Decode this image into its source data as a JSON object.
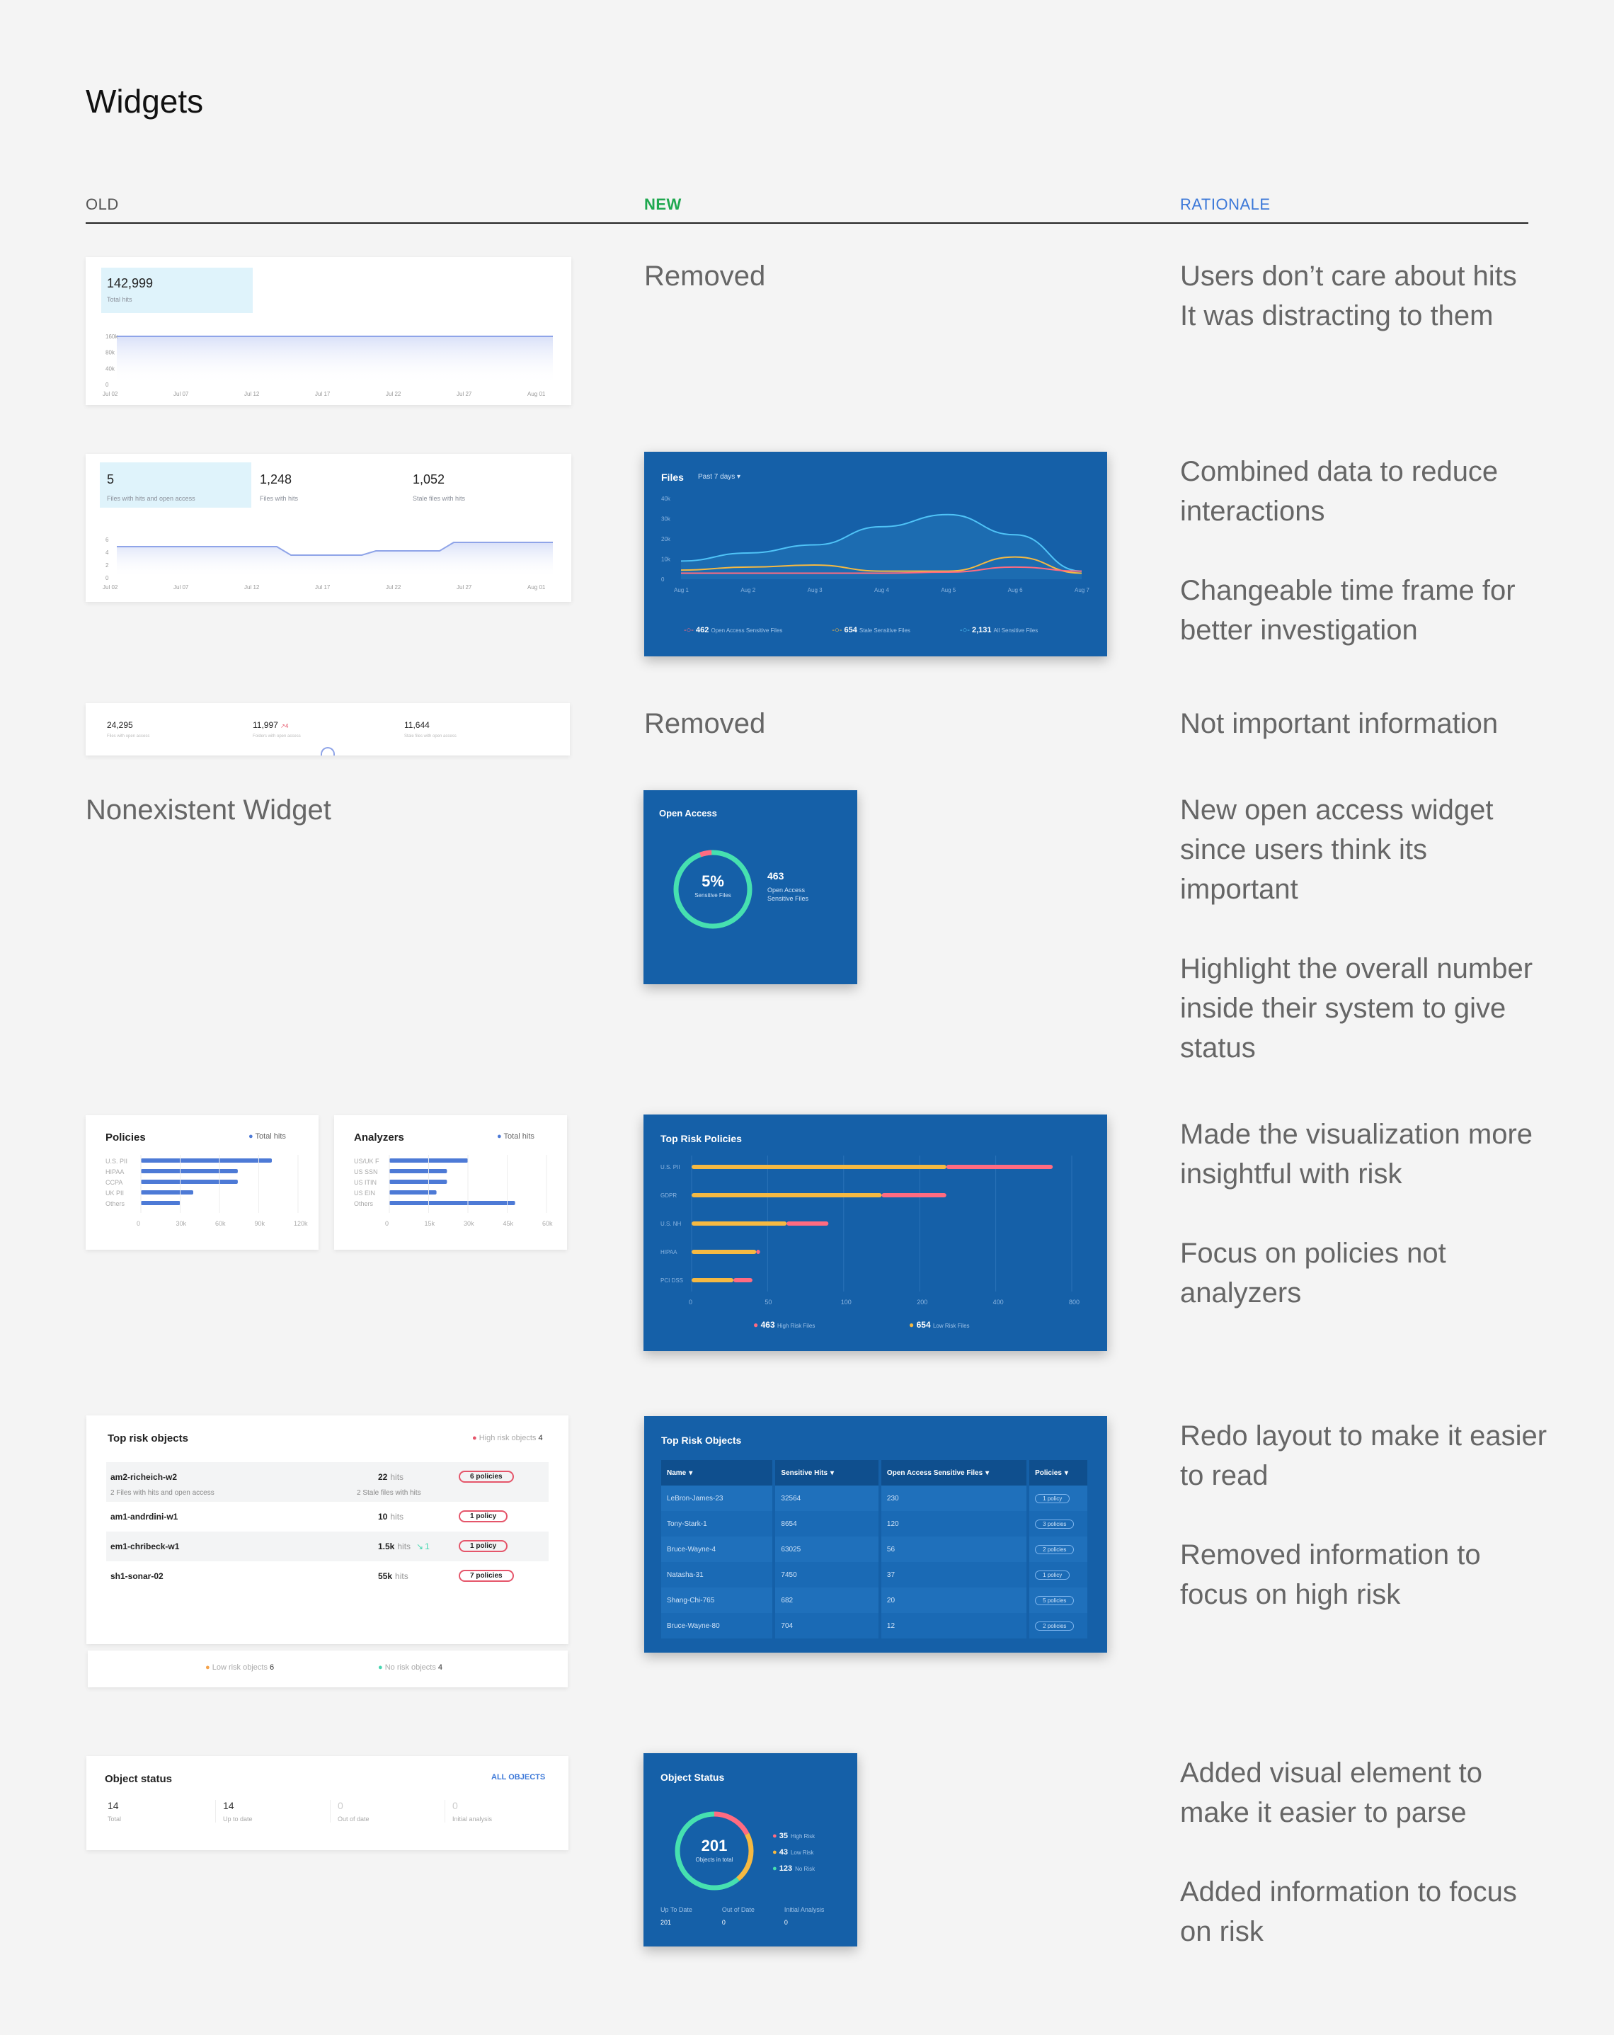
{
  "page": {
    "title": "Widgets"
  },
  "columns": {
    "old": "OLD",
    "new": "NEW",
    "rationale": "RATIONALE"
  },
  "colors": {
    "old": "#555555",
    "new": "#1fa84f",
    "rationale": "#3c78d8",
    "widget_bg": "#1560a8"
  },
  "rows": {
    "r1": {
      "new_text": "Removed",
      "rationale": [
        "Users don’t care about hits",
        "It was distracting to them"
      ]
    },
    "r2": {
      "rationale": [
        "Combined data to reduce interactions",
        "Changeable time frame for better investigation"
      ]
    },
    "r3": {
      "new_text": "Removed",
      "rationale": [
        "Not important information"
      ]
    },
    "r4": {
      "old_text": "Nonexistent Widget",
      "rationale": [
        "New open access widget since users think its important",
        "Highlight the overall number inside their system to give status"
      ]
    },
    "r5": {
      "rationale": [
        "Made the visualization more insightful with risk",
        "Focus on policies not analyzers"
      ]
    },
    "r6": {
      "rationale": [
        "Redo layout to make it easier to read",
        "Removed information to focus on high risk"
      ]
    },
    "r7": {
      "rationale": [
        "Added visual element to make it easier to parse",
        "Added information to focus on risk"
      ]
    }
  },
  "old1": {
    "value": "142,999",
    "label": "Total hits",
    "yticks": [
      "160k",
      "80k",
      "40k",
      "0"
    ],
    "xticks": [
      "Jul 02",
      "Jul 07",
      "Jul 12",
      "Jul 17",
      "Jul 22",
      "Jul 27",
      "Aug 01"
    ]
  },
  "old2": {
    "stats": [
      {
        "value": "5",
        "label": "Files with hits and open access"
      },
      {
        "value": "1,248",
        "label": "Files with hits"
      },
      {
        "value": "1,052",
        "label": "Stale files with hits"
      }
    ],
    "yticks": [
      "6",
      "4",
      "2",
      "0"
    ],
    "xticks": [
      "Jul 02",
      "Jul 07",
      "Jul 12",
      "Jul 17",
      "Jul 22",
      "Jul 27",
      "Aug 01"
    ]
  },
  "files_widget": {
    "title": "Files",
    "timeframe": "Past 7 days",
    "legend": [
      {
        "value": "462",
        "label": "Open Access Sensitive Files"
      },
      {
        "value": "654",
        "label": "Stale Sensitive Files"
      },
      {
        "value": "2,131",
        "label": "All Sensitive Files"
      }
    ]
  },
  "chart_data": [
    {
      "type": "line",
      "title": "Files",
      "x": [
        "Aug 1",
        "Aug 2",
        "Aug 3",
        "Aug 4",
        "Aug 5",
        "Aug 6",
        "Aug 7"
      ],
      "yticks": [
        "40k",
        "30k",
        "20k",
        "10k",
        "0"
      ],
      "ylim": [
        0,
        40000
      ],
      "series": [
        {
          "name": "All Sensitive Files",
          "values": [
            9000,
            13000,
            17000,
            26000,
            32000,
            22000,
            4000
          ]
        },
        {
          "name": "Stale Sensitive Files",
          "values": [
            4500,
            6000,
            7000,
            4000,
            4000,
            11000,
            3000
          ]
        },
        {
          "name": "Open Access Sensitive Files",
          "values": [
            3000,
            3000,
            3000,
            3000,
            3500,
            6000,
            4000
          ]
        }
      ]
    },
    {
      "type": "bar",
      "title": "Top Risk Policies",
      "categories": [
        "U.S. PII",
        "GDPR",
        "U.S. NH",
        "HIPAA",
        "PCI DSS"
      ],
      "xticks": [
        "0",
        "50",
        "100",
        "200",
        "400",
        "800"
      ],
      "series": [
        {
          "name": "Low Risk Files",
          "values": [
            0.67,
            0.5,
            0.25,
            0.17,
            0.11
          ]
        },
        {
          "name": "High Risk Files",
          "values": [
            0.28,
            0.17,
            0.11,
            0.01,
            0.05
          ]
        }
      ],
      "legend": [
        {
          "value": "463",
          "label": "High Risk Files"
        },
        {
          "value": "654",
          "label": "Low Risk Files"
        }
      ]
    },
    {
      "type": "bar",
      "title": "Policies",
      "categories": [
        "U.S. PII",
        "HIPAA",
        "CCPA",
        "UK PII",
        "Others"
      ],
      "values": [
        100000,
        74000,
        74000,
        40000,
        30000
      ],
      "xticks": [
        "0",
        "30k",
        "60k",
        "90k",
        "120k"
      ],
      "legend": [
        "Total hits"
      ]
    },
    {
      "type": "bar",
      "title": "Analyzers",
      "categories": [
        "US/UK F",
        "US SSN",
        "US ITIN",
        "US EIN",
        "Others"
      ],
      "values": [
        30000,
        22000,
        22000,
        18000,
        48000
      ],
      "xticks": [
        "0",
        "15k",
        "30k",
        "45k",
        "60k"
      ],
      "legend": [
        "Total hits"
      ]
    }
  ],
  "old3": {
    "stats": [
      {
        "value": "24,295",
        "label": "Files with open access"
      },
      {
        "value": "11,997",
        "label": "Folders with open access",
        "delta": "4"
      },
      {
        "value": "11,644",
        "label": "Stale files with open access"
      }
    ]
  },
  "open_access": {
    "title": "Open Access",
    "percent": "5%",
    "percent_label": "Sensitive Files",
    "value": "463",
    "label": "Open Access Sensitive Files"
  },
  "top_risk_objects_old": {
    "title": "Top risk objects",
    "high_label": "High risk objects",
    "high_count": "4",
    "rows": [
      {
        "name": "am2-richeich-w2",
        "hits": "22",
        "policies": "6 policies",
        "sub1": "2 Files with hits and open access",
        "sub2": "2 Stale files with hits"
      },
      {
        "name": "am1-andrdini-w1",
        "hits": "10",
        "policies": "1 policy"
      },
      {
        "name": "em1-chribeck-w1",
        "hits": "1.5k",
        "policies": "1 policy",
        "delta": "1"
      },
      {
        "name": "sh1-sonar-02",
        "hits": "55k",
        "policies": "7 policies"
      }
    ],
    "hits_word": "hits",
    "low_label": "Low risk objects",
    "low_count": "6",
    "no_label": "No risk objects",
    "no_count": "4"
  },
  "top_risk_objects_new": {
    "title": "Top Risk Objects",
    "headers": [
      "Name",
      "Sensitive Hits",
      "Open Access Sensitive Files",
      "Policies"
    ],
    "rows": [
      [
        "LeBron-James-23",
        "32564",
        "230",
        "1 policy"
      ],
      [
        "Tony-Stark-1",
        "8654",
        "120",
        "3 policies"
      ],
      [
        "Bruce-Wayne-4",
        "63025",
        "56",
        "2 policies"
      ],
      [
        "Natasha-31",
        "7450",
        "37",
        "1 policy"
      ],
      [
        "Shang-Chi-765",
        "682",
        "20",
        "5 policies"
      ],
      [
        "Bruce-Wayne-80",
        "704",
        "12",
        "2 policies"
      ]
    ]
  },
  "object_status_old": {
    "title": "Object status",
    "link": "ALL OBJECTS",
    "stats": [
      {
        "value": "14",
        "label": "Total"
      },
      {
        "value": "14",
        "label": "Up to date"
      },
      {
        "value": "0",
        "label": "Out of date"
      },
      {
        "value": "0",
        "label": "Initial analysis"
      }
    ]
  },
  "object_status_new": {
    "title": "Object Status",
    "total": "201",
    "total_label": "Objects in total",
    "legend": [
      {
        "value": "35",
        "label": "High Risk"
      },
      {
        "value": "43",
        "label": "Low Risk"
      },
      {
        "value": "123",
        "label": "No Risk"
      }
    ],
    "bottom": [
      {
        "label": "Up To Date",
        "value": "201"
      },
      {
        "label": "Out of Date",
        "value": "0"
      },
      {
        "label": "Initial Analysis",
        "value": "0"
      }
    ]
  }
}
